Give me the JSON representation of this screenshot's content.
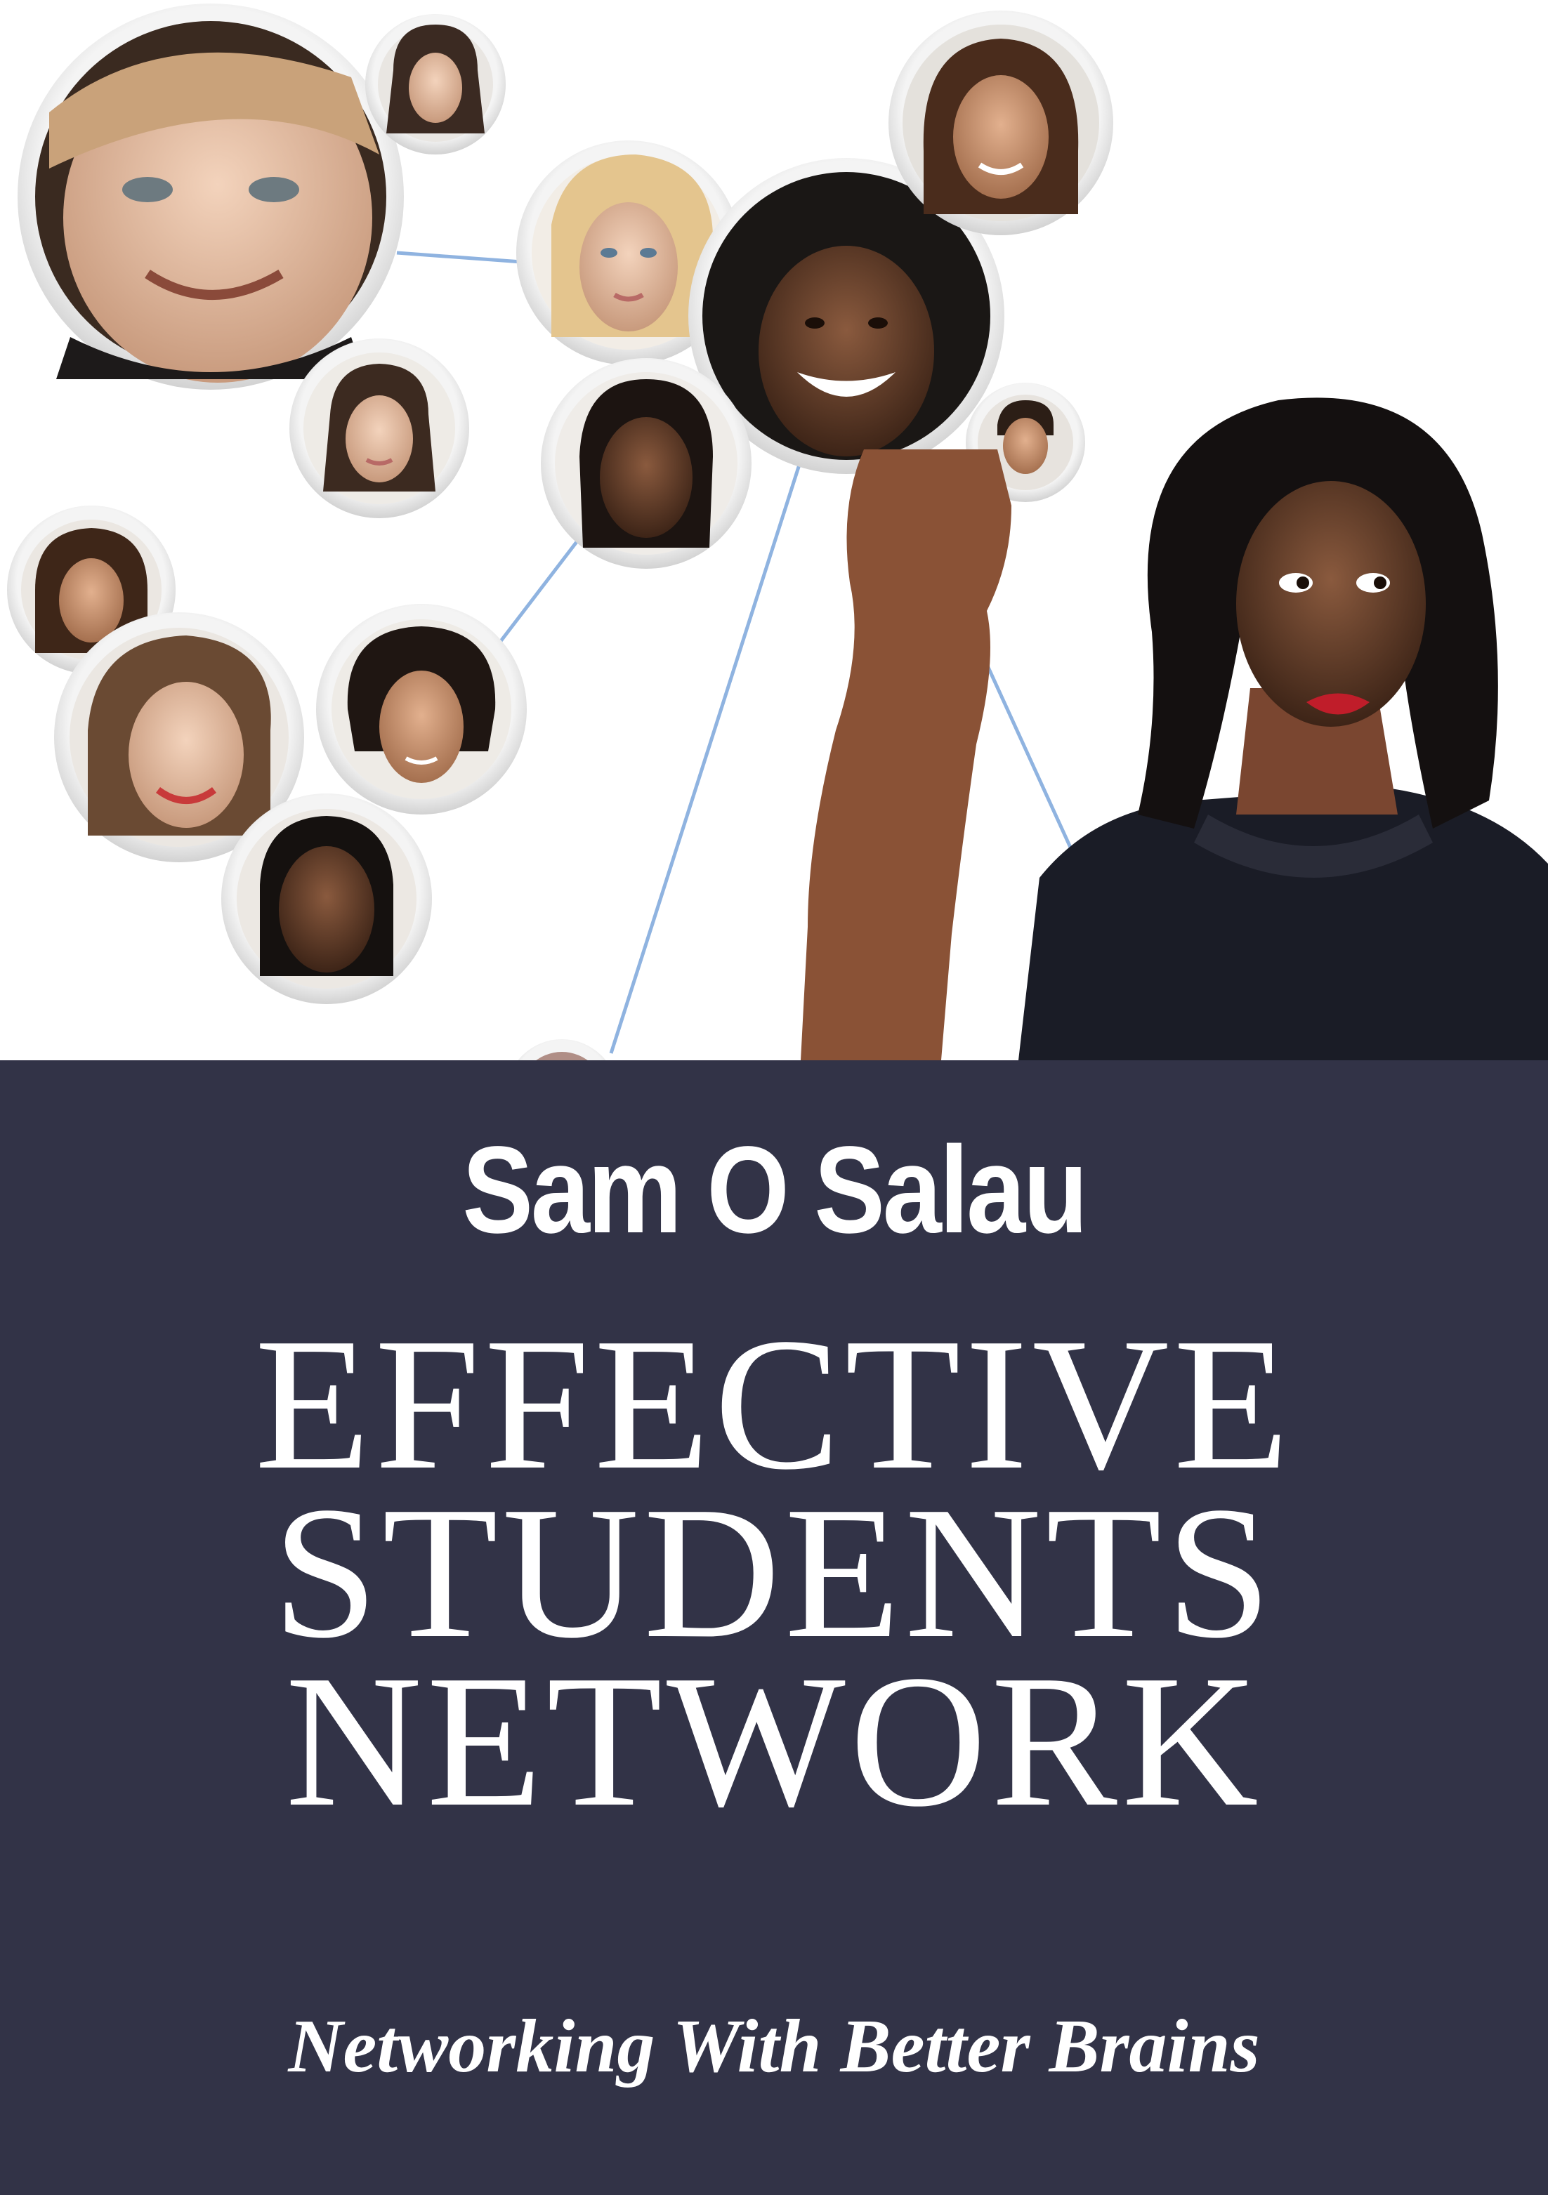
{
  "cover": {
    "author": "Sam O Salau",
    "title_lines": [
      "EFFECTIVE",
      "STUDENTS",
      "NETWORK"
    ],
    "subtitle": "Networking With Better Brains"
  },
  "colors": {
    "panel": "#323347",
    "text": "#ffffff",
    "connector": "#8fb3e0",
    "bubble_ring": "#e6e6e6"
  },
  "illustration": {
    "description_icon": "network-of-face-bubbles",
    "bubble_icon": "person-portrait-icon"
  }
}
